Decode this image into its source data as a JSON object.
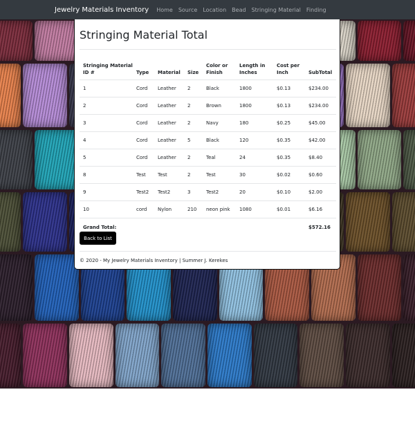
{
  "navbar": {
    "brand": "Jewelry Materials Inventory",
    "links": [
      "Home",
      "Source",
      "Location",
      "Bead",
      "Stringing Material",
      "Finding"
    ]
  },
  "page": {
    "title": "Stringing Material Total"
  },
  "table": {
    "headers": [
      "Stringing Material ID #",
      "Type",
      "Material",
      "Size",
      "Color or Finish",
      "Length in Inches",
      "Cost per Inch",
      "SubTotal"
    ],
    "rows": [
      [
        "1",
        "Cord",
        "Leather",
        "2",
        "Black",
        "1800",
        "$0.13",
        "$234.00"
      ],
      [
        "2",
        "Cord",
        "Leather",
        "2",
        "Brown",
        "1800",
        "$0.13",
        "$234.00"
      ],
      [
        "3",
        "Cord",
        "Leather",
        "2",
        "Navy",
        "180",
        "$0.25",
        "$45.00"
      ],
      [
        "4",
        "Cord",
        "Leather",
        "5",
        "Black",
        "120",
        "$0.35",
        "$42.00"
      ],
      [
        "5",
        "Cord",
        "Leather",
        "2",
        "Teal",
        "24",
        "$0.35",
        "$8.40"
      ],
      [
        "8",
        "Test",
        "Test",
        "2",
        "Test",
        "30",
        "$0.02",
        "$0.60"
      ],
      [
        "9",
        "Test2",
        "Test2",
        "3",
        "Test2",
        "20",
        "$0.10",
        "$2.00"
      ],
      [
        "10",
        "cord",
        "Nylon",
        "210",
        "neon pink",
        "1080",
        "$0.01",
        "$6.16"
      ]
    ],
    "grand_total_label": "Grand Total:",
    "grand_total_value": "$572.16"
  },
  "buttons": {
    "back_label": "Back to List"
  },
  "footer": {
    "text": "© 2020 - My Jewelry Materials Inventory | Summer J. Kerekes"
  },
  "colors": {
    "navbar": "#343a40",
    "button": "#000000"
  }
}
